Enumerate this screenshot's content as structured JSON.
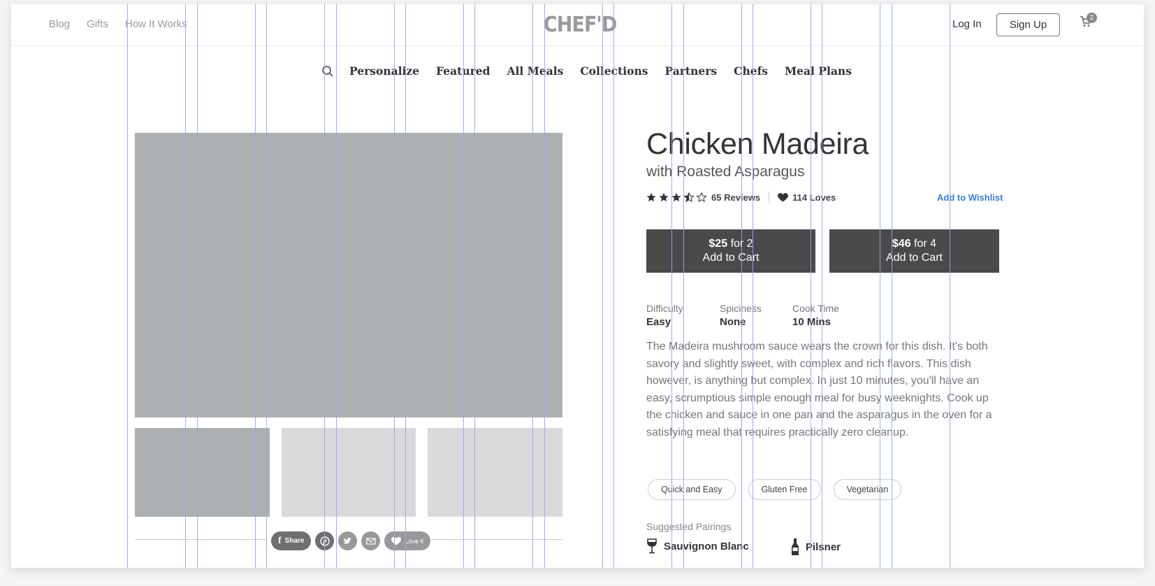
{
  "top_nav": {
    "links": [
      "Blog",
      "Gifts",
      "How It Works"
    ],
    "logo": "CHEF'D",
    "login": "Log In",
    "signup": "Sign Up",
    "cart_count": "2",
    "cart_icon": "cart-icon"
  },
  "main_nav": {
    "items": [
      "Personalize",
      "Featured",
      "All Meals",
      "Collections",
      "Partners",
      "Chefs",
      "Meal Plans"
    ],
    "search_icon": "search-icon"
  },
  "product": {
    "title": "Chicken Madeira",
    "subtitle": "with Roasted Asparagus",
    "rating": 3.5,
    "reviews": "65 Reviews",
    "loves": "114 Loves",
    "wishlist": "Add to Wishlist",
    "options": [
      {
        "price": "$25",
        "serves": "for 2",
        "action": "Add to Cart"
      },
      {
        "price": "$46",
        "serves": "for 4",
        "action": "Add to Cart"
      }
    ],
    "specs": [
      {
        "label": "Difficulty",
        "value": "Easy"
      },
      {
        "label": "Spiciness",
        "value": "None"
      },
      {
        "label": "Cook Time",
        "value": "10 Mins"
      }
    ],
    "description": "The Madeira mushroom sauce wears the crown for this dish. It's both savory and slightly sweet, with complex and rich flavors. This dish however, is anything but complex. In just 10 minutes, you'll have an easy, scrumptious simple enough meal for busy weeknights. Cook up the chicken and sauce in one pan and the asparagus in the oven for a satisfying meal that requires practically zero cleanup.",
    "tags": [
      "Quick and Easy",
      "Gluten Free",
      "Vegetarian"
    ],
    "pairings_heading": "Suggested Pairings",
    "pairings": [
      {
        "icon": "wine-glass-icon",
        "name": "Sauvignon Blanc"
      },
      {
        "icon": "beer-bottle-icon",
        "name": "Pilsner"
      }
    ]
  },
  "social": {
    "share": "Share",
    "love": "Love it",
    "icons": [
      "facebook-icon",
      "pinterest-icon",
      "twitter-icon",
      "mail-icon",
      "heart-icon"
    ]
  },
  "colors": {
    "button_bg": "#4a4a4a",
    "link": "#3b7dd8",
    "placeholder_dark": "#adb0b3",
    "placeholder_light": "#d9d9d9",
    "guide": "#8fa8f0"
  }
}
